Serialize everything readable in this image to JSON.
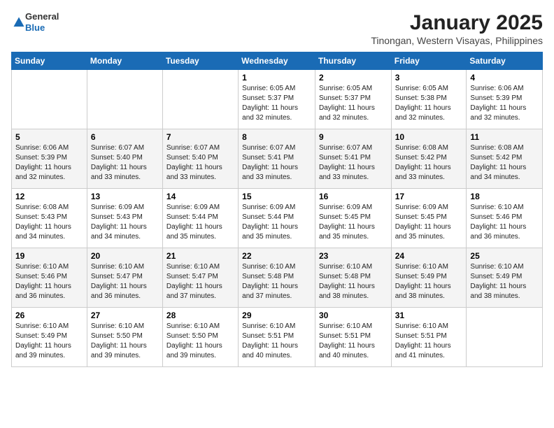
{
  "header": {
    "logo_general": "General",
    "logo_blue": "Blue",
    "month_title": "January 2025",
    "location": "Tinongan, Western Visayas, Philippines"
  },
  "days_of_week": [
    "Sunday",
    "Monday",
    "Tuesday",
    "Wednesday",
    "Thursday",
    "Friday",
    "Saturday"
  ],
  "weeks": [
    [
      {
        "day": "",
        "info": ""
      },
      {
        "day": "",
        "info": ""
      },
      {
        "day": "",
        "info": ""
      },
      {
        "day": "1",
        "info": "Sunrise: 6:05 AM\nSunset: 5:37 PM\nDaylight: 11 hours\nand 32 minutes."
      },
      {
        "day": "2",
        "info": "Sunrise: 6:05 AM\nSunset: 5:37 PM\nDaylight: 11 hours\nand 32 minutes."
      },
      {
        "day": "3",
        "info": "Sunrise: 6:05 AM\nSunset: 5:38 PM\nDaylight: 11 hours\nand 32 minutes."
      },
      {
        "day": "4",
        "info": "Sunrise: 6:06 AM\nSunset: 5:39 PM\nDaylight: 11 hours\nand 32 minutes."
      }
    ],
    [
      {
        "day": "5",
        "info": "Sunrise: 6:06 AM\nSunset: 5:39 PM\nDaylight: 11 hours\nand 32 minutes."
      },
      {
        "day": "6",
        "info": "Sunrise: 6:07 AM\nSunset: 5:40 PM\nDaylight: 11 hours\nand 33 minutes."
      },
      {
        "day": "7",
        "info": "Sunrise: 6:07 AM\nSunset: 5:40 PM\nDaylight: 11 hours\nand 33 minutes."
      },
      {
        "day": "8",
        "info": "Sunrise: 6:07 AM\nSunset: 5:41 PM\nDaylight: 11 hours\nand 33 minutes."
      },
      {
        "day": "9",
        "info": "Sunrise: 6:07 AM\nSunset: 5:41 PM\nDaylight: 11 hours\nand 33 minutes."
      },
      {
        "day": "10",
        "info": "Sunrise: 6:08 AM\nSunset: 5:42 PM\nDaylight: 11 hours\nand 33 minutes."
      },
      {
        "day": "11",
        "info": "Sunrise: 6:08 AM\nSunset: 5:42 PM\nDaylight: 11 hours\nand 34 minutes."
      }
    ],
    [
      {
        "day": "12",
        "info": "Sunrise: 6:08 AM\nSunset: 5:43 PM\nDaylight: 11 hours\nand 34 minutes."
      },
      {
        "day": "13",
        "info": "Sunrise: 6:09 AM\nSunset: 5:43 PM\nDaylight: 11 hours\nand 34 minutes."
      },
      {
        "day": "14",
        "info": "Sunrise: 6:09 AM\nSunset: 5:44 PM\nDaylight: 11 hours\nand 35 minutes."
      },
      {
        "day": "15",
        "info": "Sunrise: 6:09 AM\nSunset: 5:44 PM\nDaylight: 11 hours\nand 35 minutes."
      },
      {
        "day": "16",
        "info": "Sunrise: 6:09 AM\nSunset: 5:45 PM\nDaylight: 11 hours\nand 35 minutes."
      },
      {
        "day": "17",
        "info": "Sunrise: 6:09 AM\nSunset: 5:45 PM\nDaylight: 11 hours\nand 35 minutes."
      },
      {
        "day": "18",
        "info": "Sunrise: 6:10 AM\nSunset: 5:46 PM\nDaylight: 11 hours\nand 36 minutes."
      }
    ],
    [
      {
        "day": "19",
        "info": "Sunrise: 6:10 AM\nSunset: 5:46 PM\nDaylight: 11 hours\nand 36 minutes."
      },
      {
        "day": "20",
        "info": "Sunrise: 6:10 AM\nSunset: 5:47 PM\nDaylight: 11 hours\nand 36 minutes."
      },
      {
        "day": "21",
        "info": "Sunrise: 6:10 AM\nSunset: 5:47 PM\nDaylight: 11 hours\nand 37 minutes."
      },
      {
        "day": "22",
        "info": "Sunrise: 6:10 AM\nSunset: 5:48 PM\nDaylight: 11 hours\nand 37 minutes."
      },
      {
        "day": "23",
        "info": "Sunrise: 6:10 AM\nSunset: 5:48 PM\nDaylight: 11 hours\nand 38 minutes."
      },
      {
        "day": "24",
        "info": "Sunrise: 6:10 AM\nSunset: 5:49 PM\nDaylight: 11 hours\nand 38 minutes."
      },
      {
        "day": "25",
        "info": "Sunrise: 6:10 AM\nSunset: 5:49 PM\nDaylight: 11 hours\nand 38 minutes."
      }
    ],
    [
      {
        "day": "26",
        "info": "Sunrise: 6:10 AM\nSunset: 5:49 PM\nDaylight: 11 hours\nand 39 minutes."
      },
      {
        "day": "27",
        "info": "Sunrise: 6:10 AM\nSunset: 5:50 PM\nDaylight: 11 hours\nand 39 minutes."
      },
      {
        "day": "28",
        "info": "Sunrise: 6:10 AM\nSunset: 5:50 PM\nDaylight: 11 hours\nand 39 minutes."
      },
      {
        "day": "29",
        "info": "Sunrise: 6:10 AM\nSunset: 5:51 PM\nDaylight: 11 hours\nand 40 minutes."
      },
      {
        "day": "30",
        "info": "Sunrise: 6:10 AM\nSunset: 5:51 PM\nDaylight: 11 hours\nand 40 minutes."
      },
      {
        "day": "31",
        "info": "Sunrise: 6:10 AM\nSunset: 5:51 PM\nDaylight: 11 hours\nand 41 minutes."
      },
      {
        "day": "",
        "info": ""
      }
    ]
  ]
}
